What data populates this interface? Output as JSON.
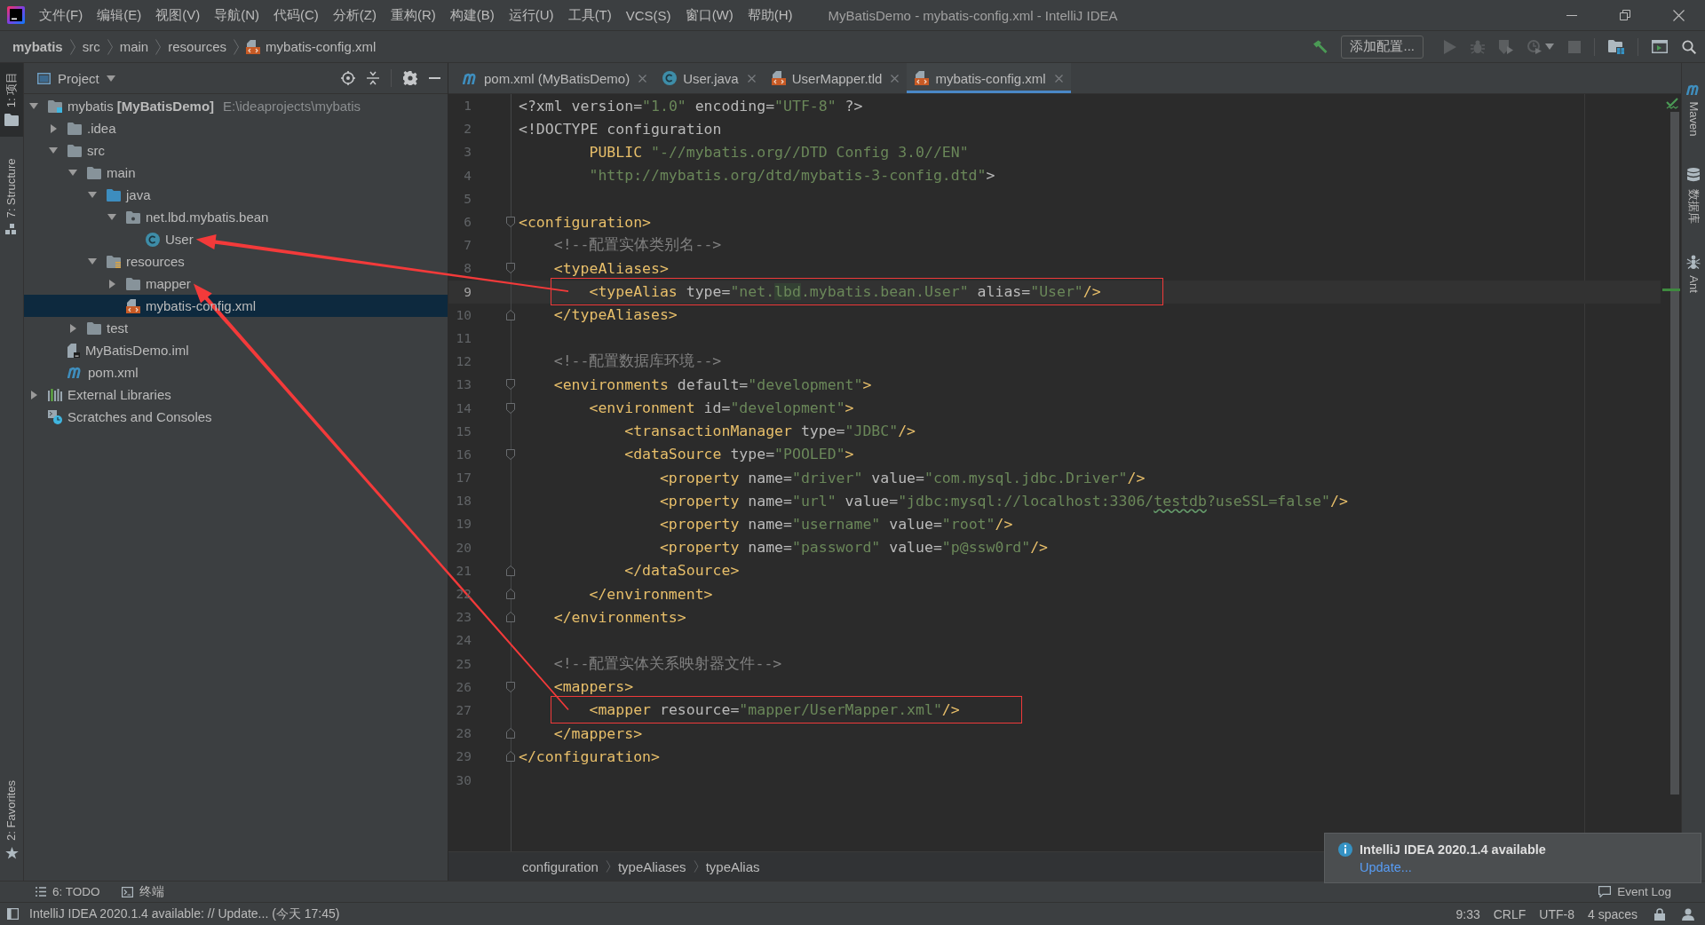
{
  "title_bar": {
    "menus": [
      "文件(F)",
      "编辑(E)",
      "视图(V)",
      "导航(N)",
      "代码(C)",
      "分析(Z)",
      "重构(R)",
      "构建(B)",
      "运行(U)",
      "工具(T)",
      "VCS(S)",
      "窗口(W)",
      "帮助(H)"
    ],
    "title": "MyBatisDemo - mybatis-config.xml - IntelliJ IDEA"
  },
  "navigation_bar": {
    "breadcrumbs": [
      {
        "label": "mybatis",
        "kind": "project"
      },
      {
        "label": "src",
        "kind": "folder"
      },
      {
        "label": "main",
        "kind": "folder"
      },
      {
        "label": "resources",
        "kind": "folder"
      },
      {
        "label": "mybatis-config.xml",
        "kind": "xml"
      }
    ],
    "run_configuration_button": "添加配置..."
  },
  "left_tool_strip": [
    {
      "label": "1: 项目",
      "kind": "project",
      "selected": true
    },
    {
      "label": "7: Structure",
      "kind": "structure",
      "selected": false
    },
    {
      "label": "2: Favorites",
      "kind": "favorites",
      "selected": false
    }
  ],
  "project_panel": {
    "title": "Project",
    "tree": [
      {
        "label": "mybatis **[MyBatisDemo]**",
        "path": "E:\\ideaprojects\\mybatis",
        "kind": "module",
        "expanded": true,
        "selected": false,
        "pointed_at": false,
        "children": [
          {
            "label": ".idea",
            "kind": "folder",
            "expanded": false,
            "selected": false,
            "pointed_at": false
          },
          {
            "label": "src",
            "kind": "folder",
            "expanded": true,
            "selected": false,
            "pointed_at": false,
            "children": [
              {
                "label": "main",
                "kind": "folder",
                "expanded": true,
                "selected": false,
                "pointed_at": false,
                "children": [
                  {
                    "label": "java",
                    "kind": "source_folder",
                    "expanded": true,
                    "selected": false,
                    "pointed_at": false,
                    "children": [
                      {
                        "label": "net.lbd.mybatis.bean",
                        "kind": "package",
                        "expanded": true,
                        "selected": false,
                        "pointed_at": false,
                        "children": [
                          {
                            "label": "User",
                            "kind": "class",
                            "selected": false,
                            "pointed_at": true
                          }
                        ]
                      }
                    ]
                  },
                  {
                    "label": "resources",
                    "kind": "resources_folder",
                    "expanded": true,
                    "selected": false,
                    "pointed_at": false,
                    "children": [
                      {
                        "label": "mapper",
                        "kind": "folder",
                        "expanded": false,
                        "selected": false,
                        "pointed_at": true
                      },
                      {
                        "label": "mybatis-config.xml",
                        "kind": "xml",
                        "selected": true,
                        "pointed_at": false
                      }
                    ]
                  }
                ]
              },
              {
                "label": "test",
                "kind": "folder",
                "expanded": false,
                "selected": false,
                "pointed_at": false
              }
            ]
          },
          {
            "label": "MyBatisDemo.iml",
            "kind": "iml",
            "selected": false,
            "pointed_at": false
          },
          {
            "label": "pom.xml",
            "kind": "maven",
            "selected": false,
            "pointed_at": false
          }
        ]
      },
      {
        "label": "External Libraries",
        "kind": "libraries",
        "expanded": false,
        "selected": false,
        "pointed_at": false
      },
      {
        "label": "Scratches and Consoles",
        "kind": "scratches",
        "selected": false,
        "pointed_at": false
      }
    ]
  },
  "editor": {
    "tabs": [
      {
        "label": "pom.xml (MyBatisDemo)",
        "kind": "maven",
        "selected": false
      },
      {
        "label": "User.java",
        "kind": "class",
        "selected": false
      },
      {
        "label": "UserMapper.tld",
        "kind": "xml",
        "selected": false
      },
      {
        "label": "mybatis-config.xml",
        "kind": "xml",
        "selected": true
      }
    ],
    "lines": [
      {
        "number": "1",
        "current": false,
        "boxed": false,
        "tokens": [
          {
            "kind": "plain",
            "text": "<?xml version="
          },
          {
            "kind": "value",
            "text": "\"1.0\""
          },
          {
            "kind": "plain",
            "text": " encoding="
          },
          {
            "kind": "value",
            "text": "\"UTF-8\""
          },
          {
            "kind": "plain",
            "text": " ?>"
          }
        ]
      },
      {
        "number": "2",
        "current": false,
        "boxed": false,
        "tokens": [
          {
            "kind": "plain",
            "text": "<!DOCTYPE configuration"
          }
        ]
      },
      {
        "number": "3",
        "current": false,
        "boxed": false,
        "tokens": [
          {
            "kind": "tag",
            "text": "        PUBLIC"
          },
          {
            "kind": "value",
            "text": " \"-//mybatis.org//DTD Config 3.0//EN\""
          }
        ]
      },
      {
        "number": "4",
        "current": false,
        "boxed": false,
        "tokens": [
          {
            "kind": "value",
            "text": "        \"http://mybatis.org/dtd/mybatis-3-config.dtd\""
          },
          {
            "kind": "plain",
            "text": ">"
          }
        ]
      },
      {
        "number": "5",
        "current": false,
        "boxed": false
      },
      {
        "number": "6",
        "current": false,
        "boxed": false,
        "fold": {
          "kind": "start"
        },
        "tokens": [
          {
            "kind": "tag",
            "text": "<configuration>"
          }
        ]
      },
      {
        "number": "7",
        "current": false,
        "boxed": false,
        "tokens": [
          {
            "kind": "comment",
            "text": "    <!--配置实体类别名-->"
          }
        ]
      },
      {
        "number": "8",
        "current": false,
        "boxed": false,
        "fold": {
          "kind": "start"
        },
        "tokens": [
          {
            "kind": "tag",
            "text": "    <typeAliases>"
          }
        ]
      },
      {
        "number": "9",
        "current": true,
        "boxed": true,
        "tokens": [
          {
            "kind": "tag",
            "text": "        <typeAlias"
          },
          {
            "kind": "plain",
            "text": " type="
          },
          {
            "kind": "value",
            "text": "\"net."
          },
          {
            "kind": "marked",
            "text": "lbd"
          },
          {
            "kind": "value",
            "text": ".mybatis.bean.User\""
          },
          {
            "kind": "plain",
            "text": " alias="
          },
          {
            "kind": "value",
            "text": "\"User\""
          },
          {
            "kind": "tag",
            "text": "/>"
          }
        ]
      },
      {
        "number": "10",
        "current": false,
        "boxed": false,
        "fold": {
          "kind": "end"
        },
        "tokens": [
          {
            "kind": "tag",
            "text": "    </typeAliases>"
          }
        ]
      },
      {
        "number": "11",
        "current": false,
        "boxed": false
      },
      {
        "number": "12",
        "current": false,
        "boxed": false,
        "tokens": [
          {
            "kind": "comment",
            "text": "    <!--配置数据库环境-->"
          }
        ]
      },
      {
        "number": "13",
        "current": false,
        "boxed": false,
        "fold": {
          "kind": "start"
        },
        "tokens": [
          {
            "kind": "tag",
            "text": "    <environments"
          },
          {
            "kind": "plain",
            "text": " default="
          },
          {
            "kind": "value",
            "text": "\"development\""
          },
          {
            "kind": "tag",
            "text": ">"
          }
        ]
      },
      {
        "number": "14",
        "current": false,
        "boxed": false,
        "fold": {
          "kind": "start"
        },
        "tokens": [
          {
            "kind": "tag",
            "text": "        <environment"
          },
          {
            "kind": "plain",
            "text": " id="
          },
          {
            "kind": "value",
            "text": "\"development\""
          },
          {
            "kind": "tag",
            "text": ">"
          }
        ]
      },
      {
        "number": "15",
        "current": false,
        "boxed": false,
        "tokens": [
          {
            "kind": "tag",
            "text": "            <transactionManager"
          },
          {
            "kind": "plain",
            "text": " type="
          },
          {
            "kind": "value",
            "text": "\"JDBC\""
          },
          {
            "kind": "tag",
            "text": "/>"
          }
        ]
      },
      {
        "number": "16",
        "current": false,
        "boxed": false,
        "fold": {
          "kind": "start"
        },
        "tokens": [
          {
            "kind": "tag",
            "text": "            <dataSource"
          },
          {
            "kind": "plain",
            "text": " type="
          },
          {
            "kind": "value",
            "text": "\"POOLED\""
          },
          {
            "kind": "tag",
            "text": ">"
          }
        ]
      },
      {
        "number": "17",
        "current": false,
        "boxed": false,
        "tokens": [
          {
            "kind": "tag",
            "text": "                <property"
          },
          {
            "kind": "plain",
            "text": " name="
          },
          {
            "kind": "value",
            "text": "\"driver\""
          },
          {
            "kind": "plain",
            "text": " value="
          },
          {
            "kind": "value",
            "text": "\"com.mysql.jdbc.Driver\""
          },
          {
            "kind": "tag",
            "text": "/>"
          }
        ]
      },
      {
        "number": "18",
        "current": false,
        "boxed": false,
        "tokens": [
          {
            "kind": "tag",
            "text": "                <property"
          },
          {
            "kind": "plain",
            "text": " name="
          },
          {
            "kind": "value",
            "text": "\"url\""
          },
          {
            "kind": "plain",
            "text": " value="
          },
          {
            "kind": "value",
            "text": "\"jdbc:mysql://localhost:3306/"
          },
          {
            "kind": "typo",
            "text": "testdb"
          },
          {
            "kind": "value",
            "text": "?useSSL=false\""
          },
          {
            "kind": "tag",
            "text": "/>"
          }
        ]
      },
      {
        "number": "19",
        "current": false,
        "boxed": false,
        "tokens": [
          {
            "kind": "tag",
            "text": "                <property"
          },
          {
            "kind": "plain",
            "text": " name="
          },
          {
            "kind": "value",
            "text": "\"username\""
          },
          {
            "kind": "plain",
            "text": " value="
          },
          {
            "kind": "value",
            "text": "\"root\""
          },
          {
            "kind": "tag",
            "text": "/>"
          }
        ]
      },
      {
        "number": "20",
        "current": false,
        "boxed": false,
        "tokens": [
          {
            "kind": "tag",
            "text": "                <property"
          },
          {
            "kind": "plain",
            "text": " name="
          },
          {
            "kind": "value",
            "text": "\"password\""
          },
          {
            "kind": "plain",
            "text": " value="
          },
          {
            "kind": "value",
            "text": "\"p@ssw0rd\""
          },
          {
            "kind": "tag",
            "text": "/>"
          }
        ]
      },
      {
        "number": "21",
        "current": false,
        "boxed": false,
        "fold": {
          "kind": "end"
        },
        "tokens": [
          {
            "kind": "tag",
            "text": "            </dataSource>"
          }
        ]
      },
      {
        "number": "22",
        "current": false,
        "boxed": false,
        "fold": {
          "kind": "end"
        },
        "tokens": [
          {
            "kind": "tag",
            "text": "        </environment>"
          }
        ]
      },
      {
        "number": "23",
        "current": false,
        "boxed": false,
        "fold": {
          "kind": "end"
        },
        "tokens": [
          {
            "kind": "tag",
            "text": "    </environments>"
          }
        ]
      },
      {
        "number": "24",
        "current": false,
        "boxed": false
      },
      {
        "number": "25",
        "current": false,
        "boxed": false,
        "tokens": [
          {
            "kind": "comment",
            "text": "    <!--配置实体关系映射器文件-->"
          }
        ]
      },
      {
        "number": "26",
        "current": false,
        "boxed": false,
        "fold": {
          "kind": "start"
        },
        "tokens": [
          {
            "kind": "tag",
            "text": "    <mappers>"
          }
        ]
      },
      {
        "number": "27",
        "current": false,
        "boxed": true,
        "tokens": [
          {
            "kind": "tag",
            "text": "        <mapper"
          },
          {
            "kind": "plain",
            "text": " resource="
          },
          {
            "kind": "value",
            "text": "\"mapper/UserMapper.xml\""
          },
          {
            "kind": "tag",
            "text": "/>"
          }
        ]
      },
      {
        "number": "28",
        "current": false,
        "boxed": false,
        "fold": {
          "kind": "end"
        },
        "tokens": [
          {
            "kind": "tag",
            "text": "    </mappers>"
          }
        ]
      },
      {
        "number": "29",
        "current": false,
        "boxed": false,
        "fold": {
          "kind": "end"
        },
        "tokens": [
          {
            "kind": "tag",
            "text": "</configuration>"
          }
        ]
      },
      {
        "number": "30",
        "current": false,
        "boxed": false
      }
    ],
    "breadcrumbs": [
      "configuration",
      "typeAliases",
      "typeAlias"
    ]
  },
  "right_tool_strip": [
    {
      "label": "Maven",
      "kind": "maven"
    },
    {
      "label": "数据库",
      "kind": "database"
    },
    {
      "label": "Ant",
      "kind": "ant"
    }
  ],
  "bottom_tool_bar": {
    "tools": [
      {
        "label": "6: TODO",
        "kind": "todo"
      },
      {
        "label": "终端",
        "kind": "terminal"
      }
    ],
    "event_log": "Event Log"
  },
  "status_bar": {
    "message": "IntelliJ IDEA 2020.1.4 available: // Update... (今天 17:45)",
    "items": [
      "9:33",
      "CRLF",
      "UTF-8",
      "4 spaces"
    ]
  },
  "notification": {
    "title": "IntelliJ IDEA 2020.1.4 available",
    "link": "Update..."
  }
}
